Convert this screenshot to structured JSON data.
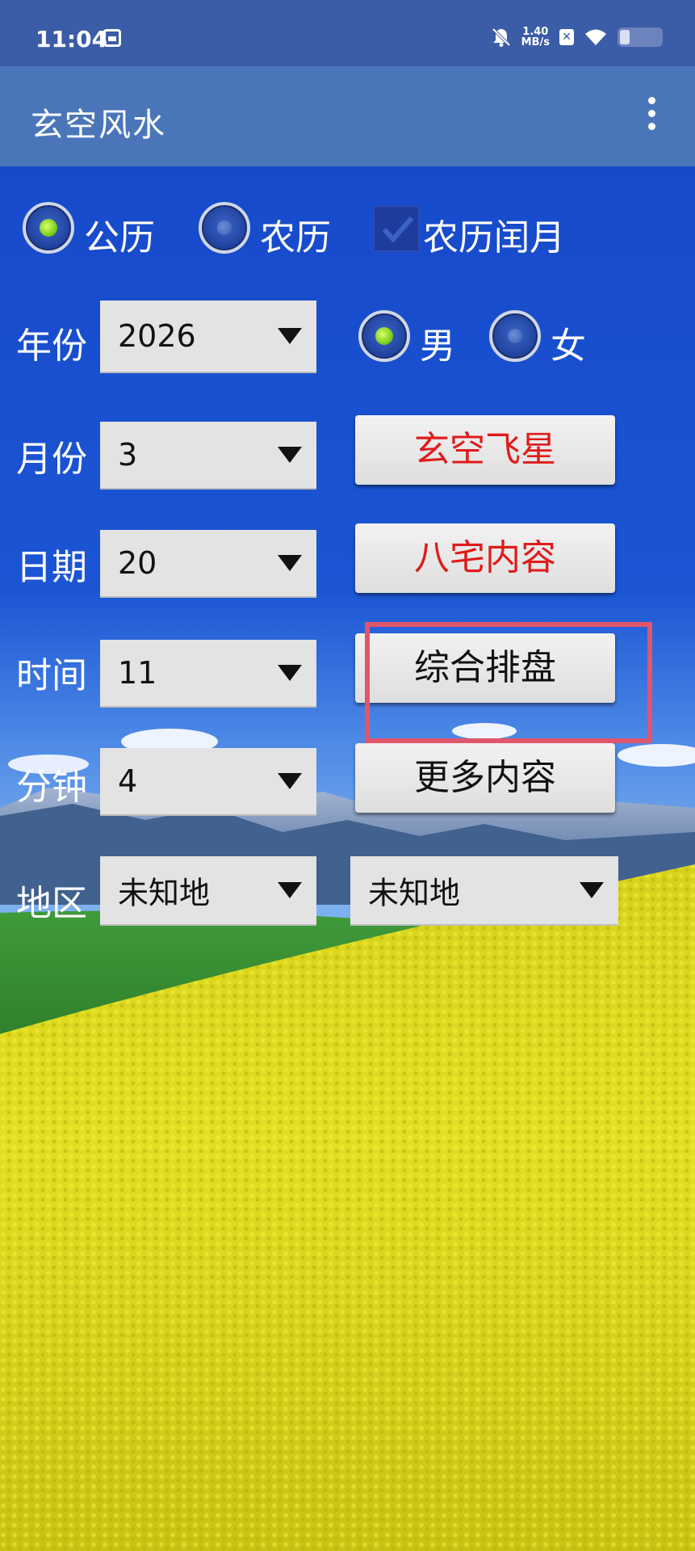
{
  "status_bar": {
    "time": "11:04",
    "net_speed_value": "1.40",
    "net_speed_unit": "MB/s",
    "x_badge": "✕"
  },
  "app_bar": {
    "title": "玄空风水"
  },
  "calendar": {
    "solar_label": "公历",
    "lunar_label": "农历",
    "leap_label": "农历闰月",
    "selected": "solar",
    "leap_checked": true
  },
  "gender": {
    "male_label": "男",
    "female_label": "女",
    "selected": "male"
  },
  "fields": {
    "year_label": "年份",
    "year_value": "2026",
    "month_label": "月份",
    "month_value": "3",
    "day_label": "日期",
    "day_value": "20",
    "hour_label": "时间",
    "hour_value": "11",
    "minute_label": "分钟",
    "minute_value": "4",
    "region_label": "地区",
    "region_value_1": "未知地",
    "region_value_2": "未知地"
  },
  "buttons": {
    "flying_star": "玄空飞星",
    "eight_mansions": "八宅内容",
    "comprehensive": "综合排盘",
    "more": "更多内容"
  },
  "colors": {
    "red_button_text": "#e01b1b",
    "black_button_text": "#111111",
    "highlight": "#e0566b"
  }
}
